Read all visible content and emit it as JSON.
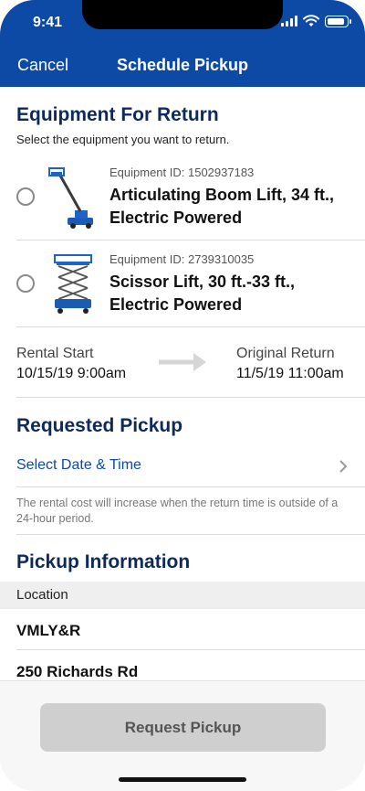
{
  "status": {
    "time": "9:41"
  },
  "nav": {
    "cancel_label": "Cancel",
    "title": "Schedule Pickup"
  },
  "equipment_section": {
    "title": "Equipment For Return",
    "subtitle": "Select the equipment you want to return.",
    "items": [
      {
        "id_label": "Equipment ID: 1502937183",
        "name": "Articulating Boom Lift, 34 ft., Electric Powered",
        "icon": "boom-lift-icon"
      },
      {
        "id_label": "Equipment ID: 2739310035",
        "name": "Scissor Lift, 30 ft.-33 ft., Electric Powered",
        "icon": "scissor-lift-icon"
      }
    ]
  },
  "rental": {
    "start_label": "Rental Start",
    "start_value": "10/15/19 9:00am",
    "return_label": "Original Return",
    "return_value": "11/5/19 11:00am",
    "arrow_icon": "arrow-right-icon"
  },
  "requested_pickup": {
    "title": "Requested Pickup",
    "select_label": "Select Date & Time",
    "note": "The rental cost will increase when the return time is outside of a 24-hour period."
  },
  "pickup_info": {
    "title": "Pickup Information",
    "location_label": "Location",
    "location_lines": [
      "VMLY&R",
      "250 Richards Rd"
    ]
  },
  "footer": {
    "button_label": "Request Pickup"
  },
  "colors": {
    "brand": "#0c4aa6",
    "heading": "#0e2a5b",
    "button_disabled": "#cfcfcf"
  }
}
